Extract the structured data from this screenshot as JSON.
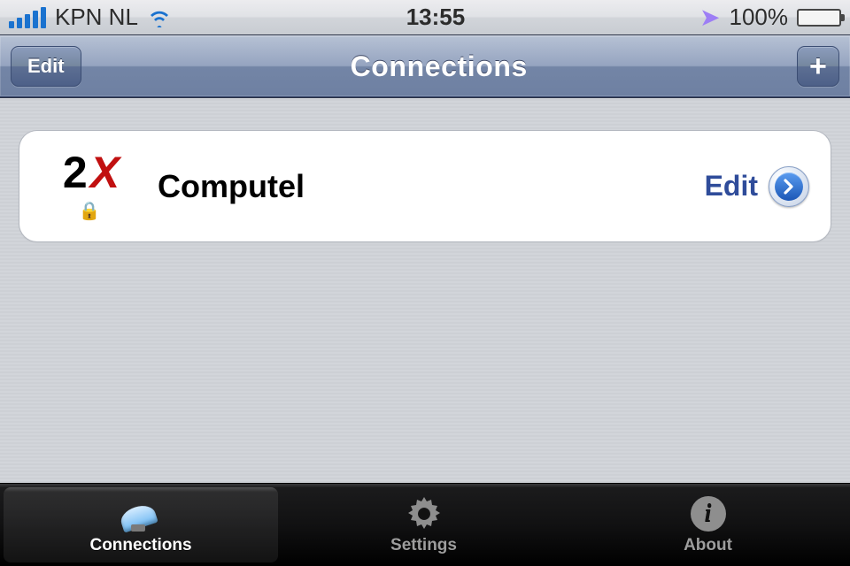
{
  "status": {
    "carrier": "KPN NL",
    "time": "13:55",
    "battery": "100%"
  },
  "navbar": {
    "title": "Connections",
    "left_btn": "Edit",
    "right_btn": "+"
  },
  "connection": {
    "logo_text_2": "2",
    "logo_text_x": "X",
    "name": "Computel",
    "edit_label": "Edit"
  },
  "tabs": {
    "connections": "Connections",
    "settings": "Settings",
    "about": "About"
  }
}
